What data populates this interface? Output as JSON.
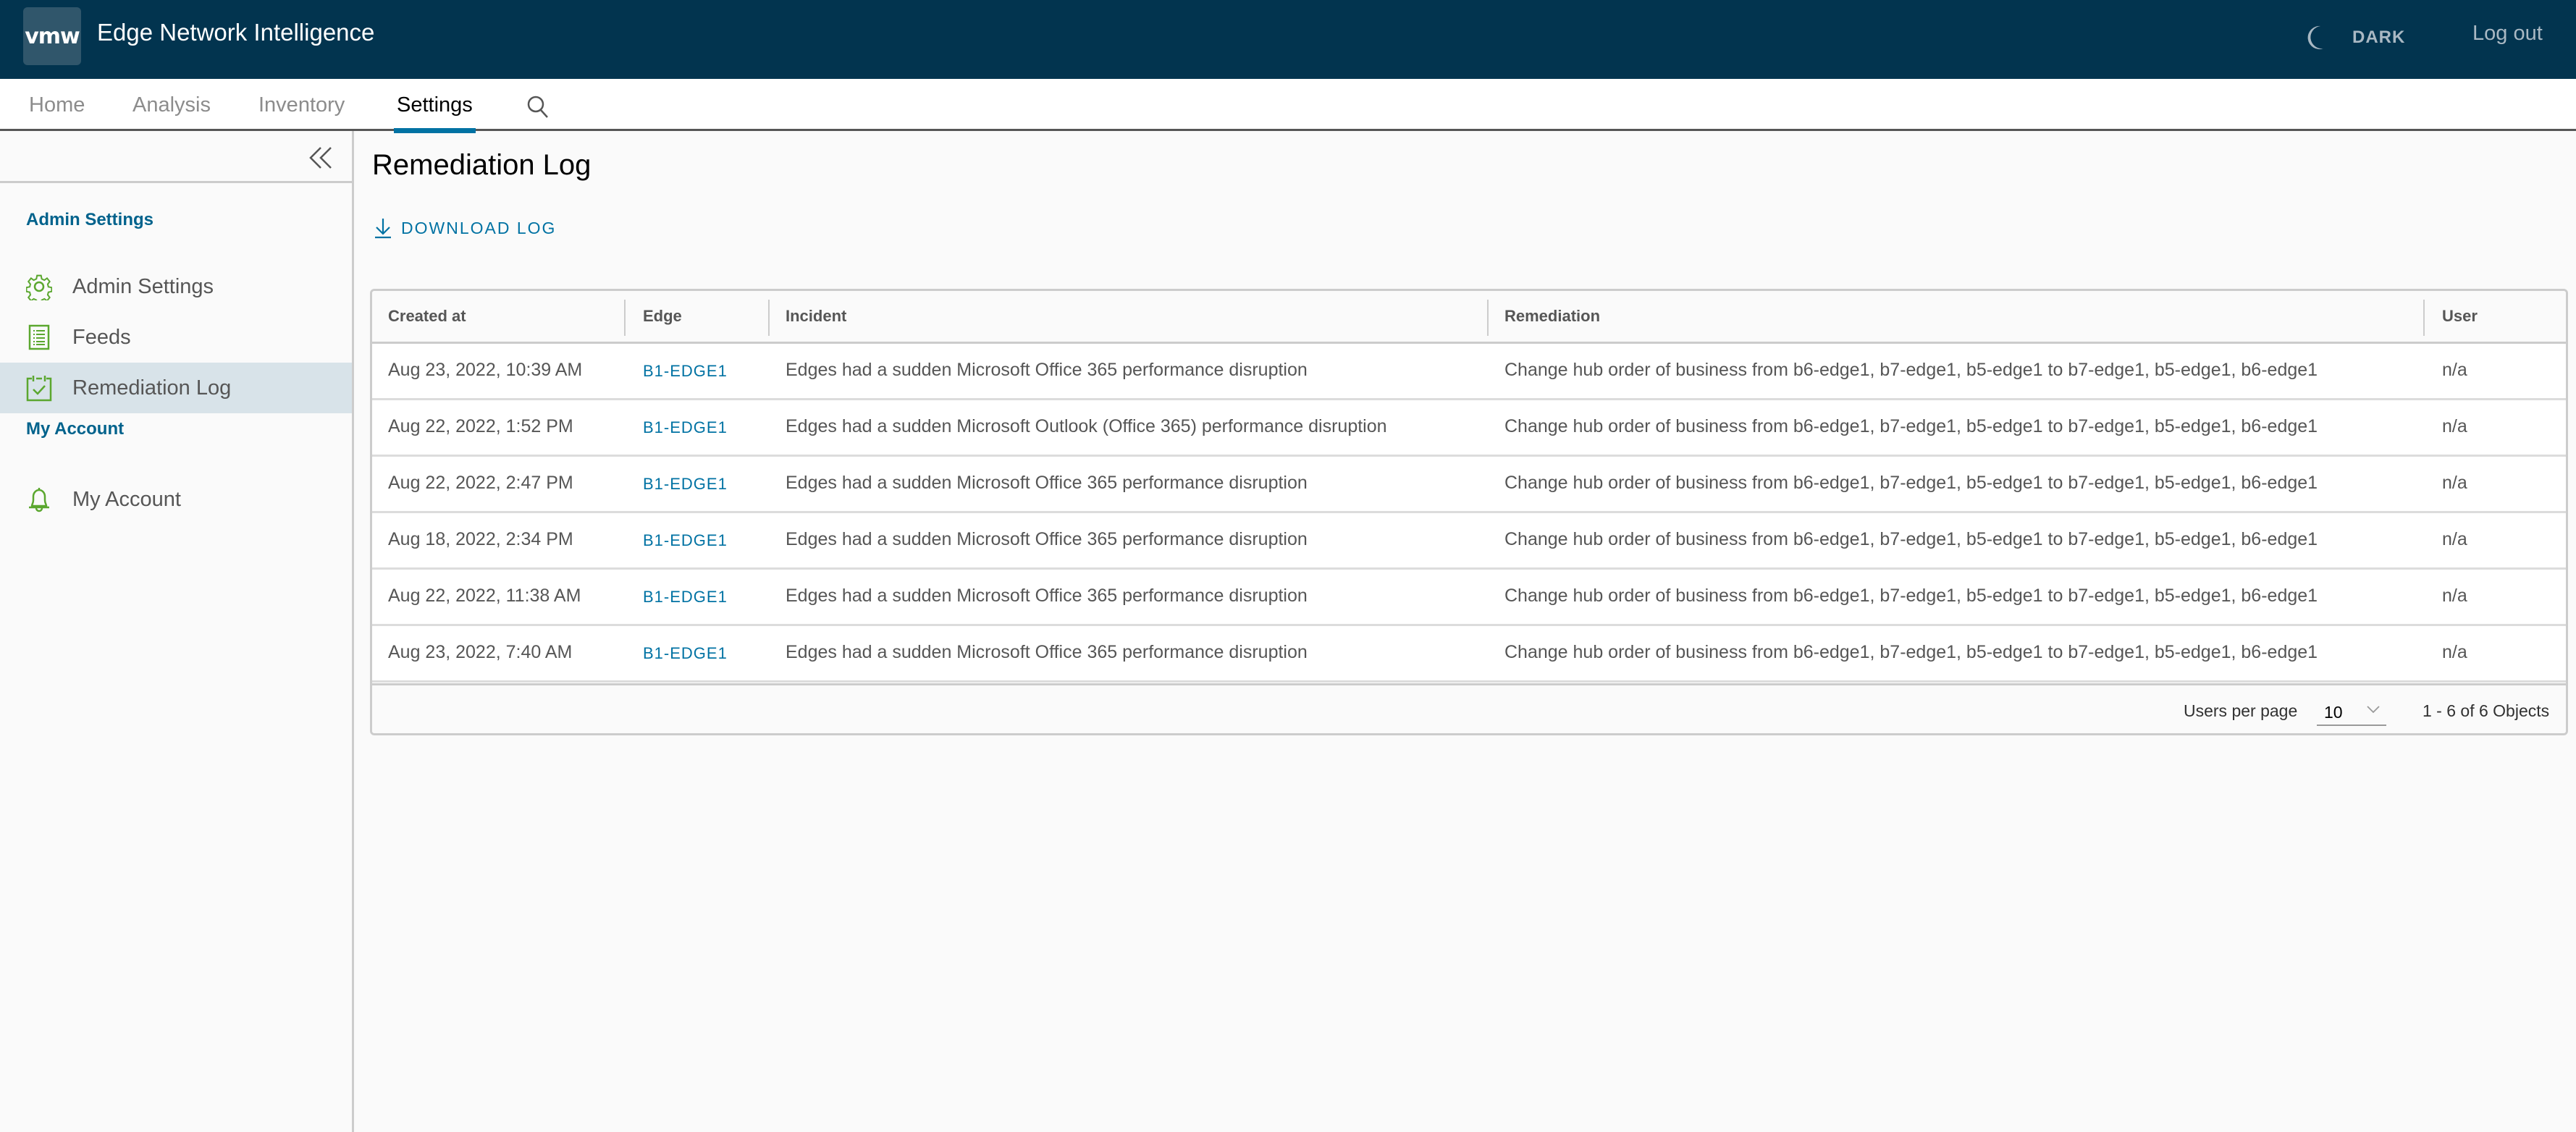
{
  "header": {
    "logo_text": "vmw",
    "app_title": "Edge Network Intelligence",
    "theme_label": "DARK",
    "logout_label": "Log out"
  },
  "nav": {
    "tabs": [
      {
        "label": "Home",
        "active": false
      },
      {
        "label": "Analysis",
        "active": false
      },
      {
        "label": "Inventory",
        "active": false
      },
      {
        "label": "Settings",
        "active": true
      }
    ]
  },
  "sidebar": {
    "sections": [
      {
        "title": "Admin Settings",
        "items": [
          {
            "label": "Admin Settings",
            "icon": "gear-icon",
            "active": false
          },
          {
            "label": "Feeds",
            "icon": "list-document-icon",
            "active": false
          },
          {
            "label": "Remediation Log",
            "icon": "calendar-check-icon",
            "active": true
          }
        ]
      },
      {
        "title": "My Account",
        "items": [
          {
            "label": "My Account",
            "icon": "bell-icon",
            "active": false
          }
        ]
      }
    ]
  },
  "main": {
    "title": "Remediation Log",
    "download_label": "DOWNLOAD LOG",
    "table": {
      "columns": [
        "Created at",
        "Edge",
        "Incident",
        "Remediation",
        "User"
      ],
      "rows": [
        {
          "created_at": "Aug 23, 2022, 10:39 AM",
          "edge": "B1-EDGE1",
          "incident": "Edges had a sudden Microsoft Office 365 performance disruption",
          "remediation": "Change hub order of business from b6-edge1, b7-edge1, b5-edge1 to b7-edge1, b5-edge1, b6-edge1",
          "user": "n/a"
        },
        {
          "created_at": "Aug 22, 2022, 1:52 PM",
          "edge": "B1-EDGE1",
          "incident": "Edges had a sudden Microsoft Outlook (Office 365) performance disruption",
          "remediation": "Change hub order of business from b6-edge1, b7-edge1, b5-edge1 to b7-edge1, b5-edge1, b6-edge1",
          "user": "n/a"
        },
        {
          "created_at": "Aug 22, 2022, 2:47 PM",
          "edge": "B1-EDGE1",
          "incident": "Edges had a sudden Microsoft Office 365 performance disruption",
          "remediation": "Change hub order of business from b6-edge1, b7-edge1, b5-edge1 to b7-edge1, b5-edge1, b6-edge1",
          "user": "n/a"
        },
        {
          "created_at": "Aug 18, 2022, 2:34 PM",
          "edge": "B1-EDGE1",
          "incident": "Edges had a sudden Microsoft Office 365 performance disruption",
          "remediation": "Change hub order of business from b6-edge1, b7-edge1, b5-edge1 to b7-edge1, b5-edge1, b6-edge1",
          "user": "n/a"
        },
        {
          "created_at": "Aug 22, 2022, 11:38 AM",
          "edge": "B1-EDGE1",
          "incident": "Edges had a sudden Microsoft Office 365 performance disruption",
          "remediation": "Change hub order of business from b6-edge1, b7-edge1, b5-edge1 to b7-edge1, b5-edge1, b6-edge1",
          "user": "n/a"
        },
        {
          "created_at": "Aug 23, 2022, 7:40 AM",
          "edge": "B1-EDGE1",
          "incident": "Edges had a sudden Microsoft Office 365 performance disruption",
          "remediation": "Change hub order of business from b6-edge1, b7-edge1, b5-edge1 to b7-edge1, b5-edge1, b6-edge1",
          "user": "n/a"
        }
      ]
    },
    "footer": {
      "page_size_label": "Users per page",
      "page_size_value": "10",
      "count_text": "1 - 6 of 6 Objects"
    }
  },
  "colors": {
    "header_bg": "#02344f",
    "accent": "#0072a3",
    "section_title": "#00628c",
    "icon_green": "#5ba72f",
    "active_item_bg": "#d8e3e9"
  }
}
